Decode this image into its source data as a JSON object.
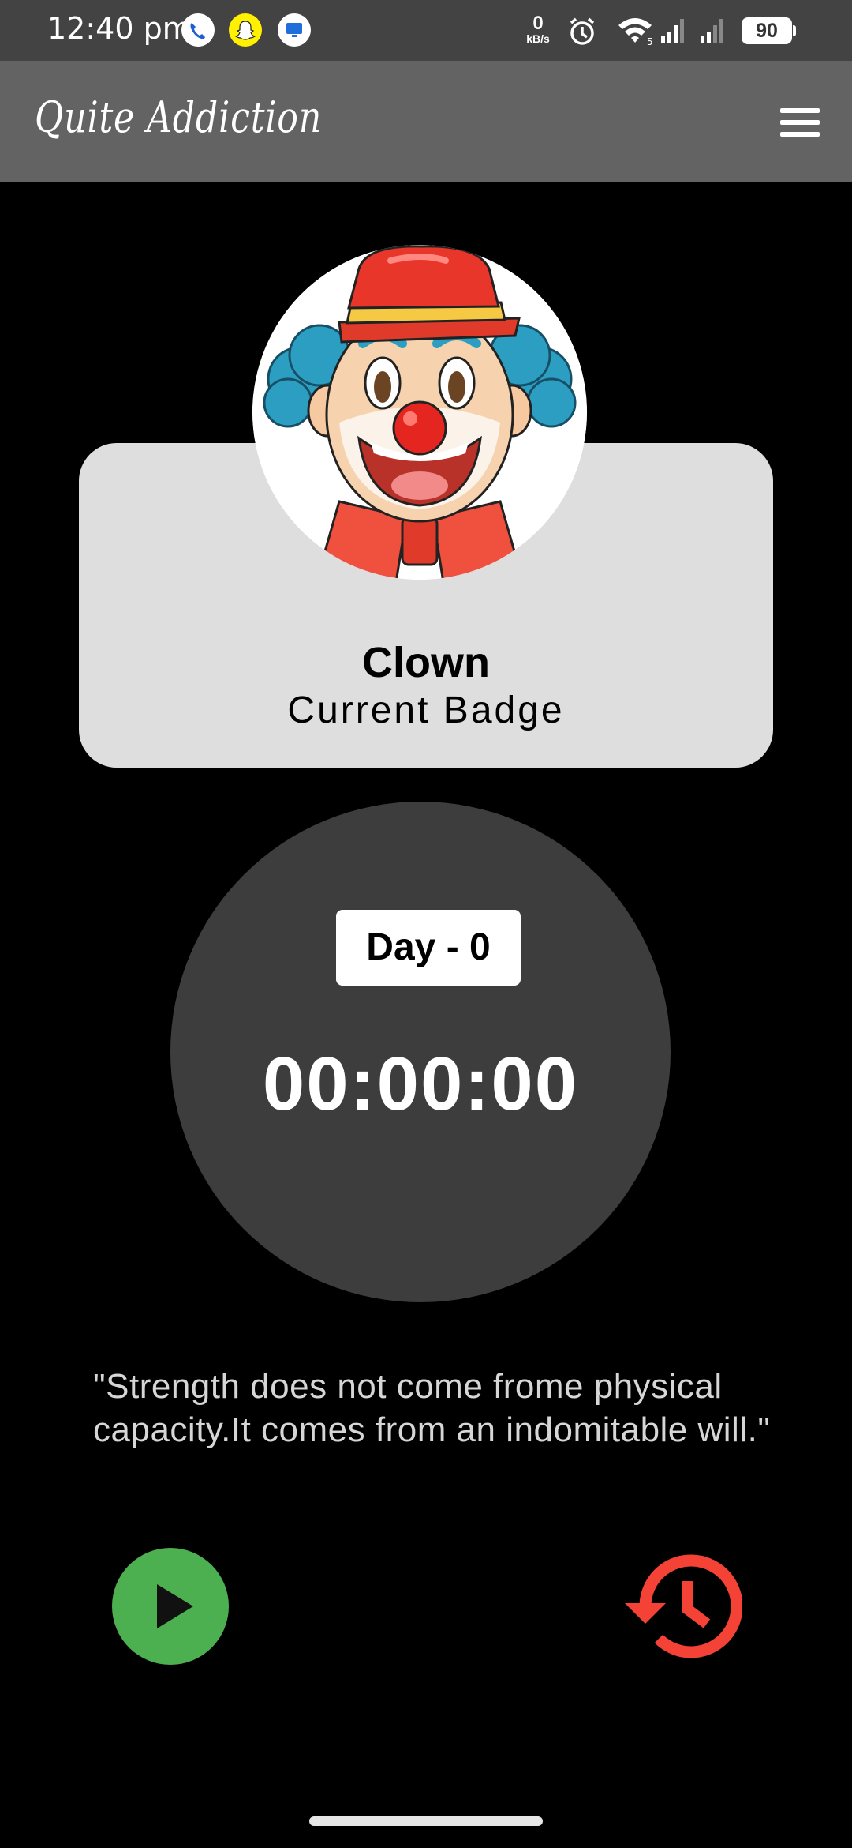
{
  "status_bar": {
    "time": "12:40 pm",
    "net_speed_value": "0",
    "net_speed_unit": "kB/s",
    "battery": "90",
    "icons": [
      "phone-call-icon",
      "snapchat-icon",
      "monitor-app-icon",
      "alarm-icon",
      "wifi-icon",
      "signal-icon",
      "signal-icon"
    ]
  },
  "app_bar": {
    "title": "Quite  Addiction",
    "menu_icon": "hamburger-menu-icon"
  },
  "badge": {
    "name": "Clown",
    "subtitle": "Current Badge",
    "image": "clown-face"
  },
  "timer": {
    "day_label": "Day - 0",
    "elapsed": "00:00:00"
  },
  "quote": "\"Strength does not come frome physical capacity.It comes from an indomitable will.\"",
  "controls": {
    "play_icon": "play-icon",
    "history_icon": "history-icon"
  },
  "colors": {
    "status_bar": "#434343",
    "app_bar": "#636363",
    "badge_card": "#dedede",
    "timer_circle": "#3d3d3d",
    "play": "#4caf50",
    "history": "#f44336"
  }
}
